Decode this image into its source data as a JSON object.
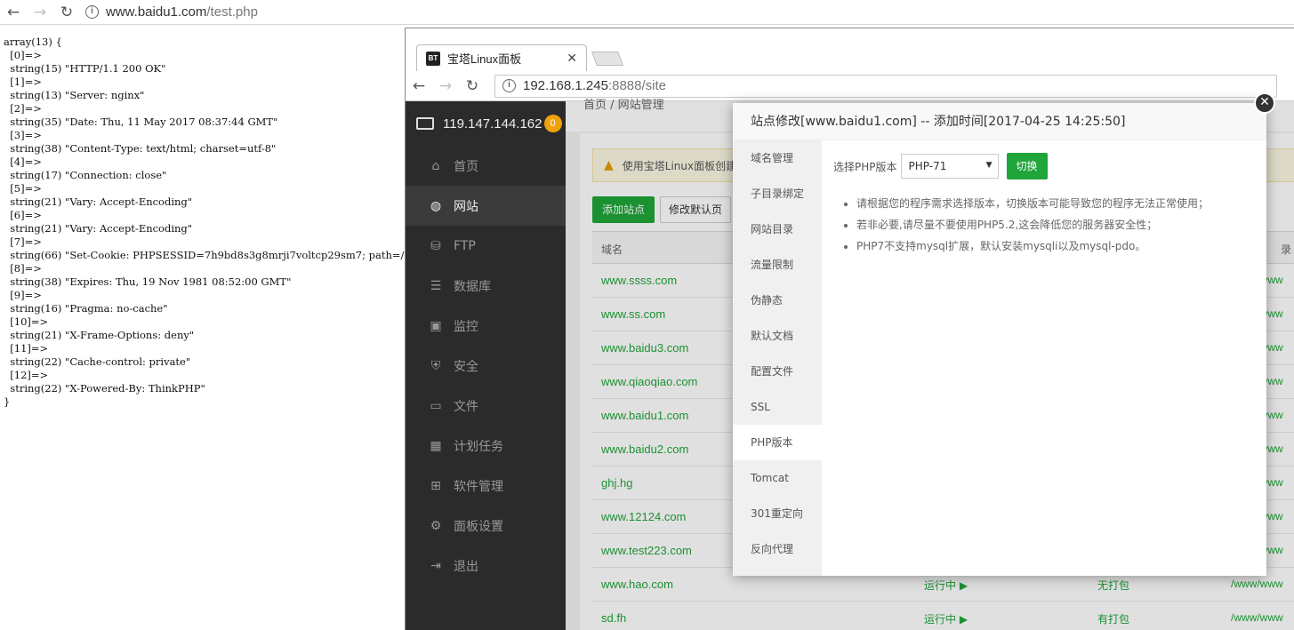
{
  "back_browser": {
    "url_host": "www.baidu1.com",
    "url_path": "/test.php"
  },
  "dump_lines": [
    "array(13) {",
    "  [0]=>",
    "  string(15) \"HTTP/1.1 200 OK\"",
    "  [1]=>",
    "  string(13) \"Server: nginx\"",
    "  [2]=>",
    "  string(35) \"Date: Thu, 11 May 2017 08:37:44 GMT\"",
    "  [3]=>",
    "  string(38) \"Content-Type: text/html; charset=utf-8\"",
    "  [4]=>",
    "  string(17) \"Connection: close\"",
    "  [5]=>",
    "  string(21) \"Vary: Accept-Encoding\"",
    "  [6]=>",
    "  string(21) \"Vary: Accept-Encoding\"",
    "  [7]=>",
    "  string(66) \"Set-Cookie: PHPSESSID=7h9bd8s3g8mrji7voltcp29sm7; path=/",
    "  [8]=>",
    "  string(38) \"Expires: Thu, 19 Nov 1981 08:52:00 GMT\"",
    "  [9]=>",
    "  string(16) \"Pragma: no-cache\"",
    "  [10]=>",
    "  string(21) \"X-Frame-Options: deny\"",
    "  [11]=>",
    "  string(22) \"Cache-control: private\"",
    "  [12]=>",
    "  string(22) \"X-Powered-By: ThinkPHP\"",
    "}"
  ],
  "front_browser": {
    "tab_title": "宝塔Linux面板",
    "tab_favicon": "BT",
    "url_host": "192.168.1.245",
    "url_rest": ":8888/site"
  },
  "sidebar": {
    "server_ip": "119.147.144.162",
    "badge_count": "0",
    "items": [
      {
        "label": "首页",
        "icon": "home-icon"
      },
      {
        "label": "网站",
        "icon": "globe-icon"
      },
      {
        "label": "FTP",
        "icon": "ftp-icon"
      },
      {
        "label": "数据库",
        "icon": "database-icon"
      },
      {
        "label": "监控",
        "icon": "monitor-icon"
      },
      {
        "label": "安全",
        "icon": "shield-icon"
      },
      {
        "label": "文件",
        "icon": "folder-icon"
      },
      {
        "label": "计划任务",
        "icon": "calendar-icon"
      },
      {
        "label": "软件管理",
        "icon": "grid-icon"
      },
      {
        "label": "面板设置",
        "icon": "gear-icon"
      },
      {
        "label": "退出",
        "icon": "logout-icon"
      }
    ]
  },
  "content": {
    "breadcrumb": "首页 / 网站管理",
    "warning_text": "使用宝塔Linux面板创建",
    "add_site_label": "添加站点",
    "default_page_label": "修改默认页",
    "table_header_domain": "域名",
    "table_header_path": "录",
    "rows": [
      {
        "domain": "www.ssss.com",
        "status": "",
        "backup": "",
        "path": "/www/www"
      },
      {
        "domain": "www.ss.com",
        "status": "",
        "backup": "",
        "path": "/www/www"
      },
      {
        "domain": "www.baidu3.com",
        "status": "",
        "backup": "",
        "path": "/www/www"
      },
      {
        "domain": "www.qiaoqiao.com",
        "status": "",
        "backup": "",
        "path": "/www/www"
      },
      {
        "domain": "www.baidu1.com",
        "status": "",
        "backup": "",
        "path": "/www/www"
      },
      {
        "domain": "www.baidu2.com",
        "status": "",
        "backup": "",
        "path": "/www/www"
      },
      {
        "domain": "ghj.hg",
        "status": "",
        "backup": "",
        "path": "/www/www"
      },
      {
        "domain": "www.12124.com",
        "status": "",
        "backup": "",
        "path": "/www/www"
      },
      {
        "domain": "www.test223.com",
        "status": "",
        "backup": "",
        "path": "/www/www"
      },
      {
        "domain": "www.hao.com",
        "status": "运行中 ▶",
        "backup": "无打包",
        "path": "/www/www"
      },
      {
        "domain": "sd.fh",
        "status": "运行中 ▶",
        "backup": "有打包",
        "path": "/www/www"
      }
    ]
  },
  "dialog": {
    "title": "站点修改[www.baidu1.com] -- 添加时间[2017-04-25 14:25:50]",
    "nav": [
      "域名管理",
      "子目录绑定",
      "网站目录",
      "流量限制",
      "伪静态",
      "默认文档",
      "配置文件",
      "SSL",
      "PHP版本",
      "Tomcat",
      "301重定向",
      "反向代理"
    ],
    "active_nav": "PHP版本",
    "php_label": "选择PHP版本",
    "php_selected": "PHP-71",
    "switch_label": "切换",
    "notes": [
      "请根据您的程序需求选择版本，切换版本可能导致您的程序无法正常使用；",
      "若非必要,请尽量不要使用PHP5.2,这会降低您的服务器安全性；",
      "PHP7不支持mysql扩展，默认安装mysqli以及mysql-pdo。"
    ]
  },
  "colors": {
    "accent": "#20a53a",
    "sidebar_bg": "#2b2b2b",
    "badge": "#f0a20c"
  }
}
